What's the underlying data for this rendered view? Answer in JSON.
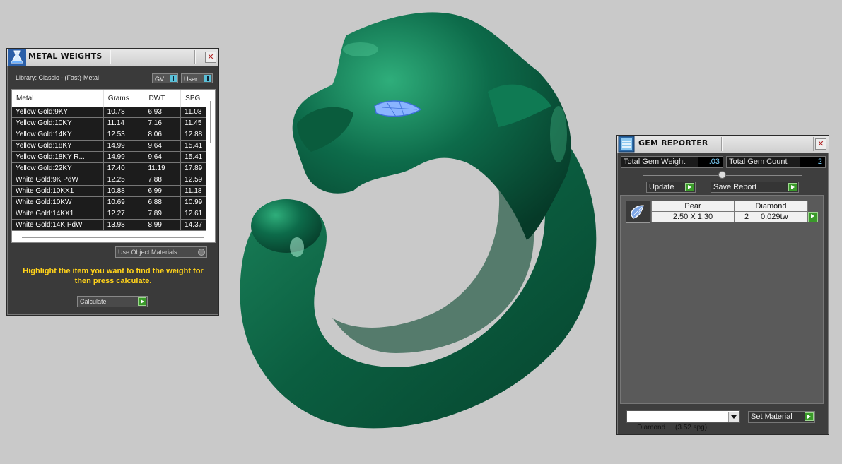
{
  "metal_weights": {
    "title": "METAL WEIGHTS",
    "library": "Library: Classic - (Fast)-Metal",
    "gv_label": "GV",
    "user_label": "User",
    "columns": [
      "Metal",
      "Grams",
      "DWT",
      "SPG"
    ],
    "rows": [
      [
        "Yellow Gold:9KY",
        "10.78",
        "6.93",
        "11.08"
      ],
      [
        "Yellow Gold:10KY",
        "11.14",
        "7.16",
        "11.45"
      ],
      [
        "Yellow Gold:14KY",
        "12.53",
        "8.06",
        "12.88"
      ],
      [
        "Yellow Gold:18KY",
        "14.99",
        "9.64",
        "15.41"
      ],
      [
        "Yellow Gold:18KY R...",
        "14.99",
        "9.64",
        "15.41"
      ],
      [
        "Yellow Gold:22KY",
        "17.40",
        "11.19",
        "17.89"
      ],
      [
        "White Gold:9K PdW",
        "12.25",
        "7.88",
        "12.59"
      ],
      [
        "White Gold:10KX1",
        "10.88",
        "6.99",
        "11.18"
      ],
      [
        "White Gold:10KW",
        "10.69",
        "6.88",
        "10.99"
      ],
      [
        "White Gold:14KX1",
        "12.27",
        "7.89",
        "12.61"
      ],
      [
        "White Gold:14K PdW",
        "13.98",
        "8.99",
        "14.37"
      ]
    ],
    "use_object_materials": "Use Object Materials",
    "hint": "Highlight the item you want to find the weight for then press calculate.",
    "calculate_label": "Calculate"
  },
  "gem_reporter": {
    "title": "GEM REPORTER",
    "total_weight_label": "Total Gem Weight",
    "total_weight_value": ".03",
    "total_count_label": "Total Gem Count",
    "total_count_value": "2",
    "update_label": "Update",
    "save_report_label": "Save Report",
    "gem_row": {
      "shape": "Pear",
      "size": "2.50 X 1.30",
      "stone": "Diamond",
      "count": "2",
      "weight": "0.029tw"
    },
    "material_select": "Diamond     (3.52 spg)",
    "set_material_label": "Set Material"
  },
  "colors": {
    "model": "#0d6b4a",
    "eye": "#8ab4ff",
    "hint": "#ffd21a",
    "background": "#c9c9c9"
  }
}
